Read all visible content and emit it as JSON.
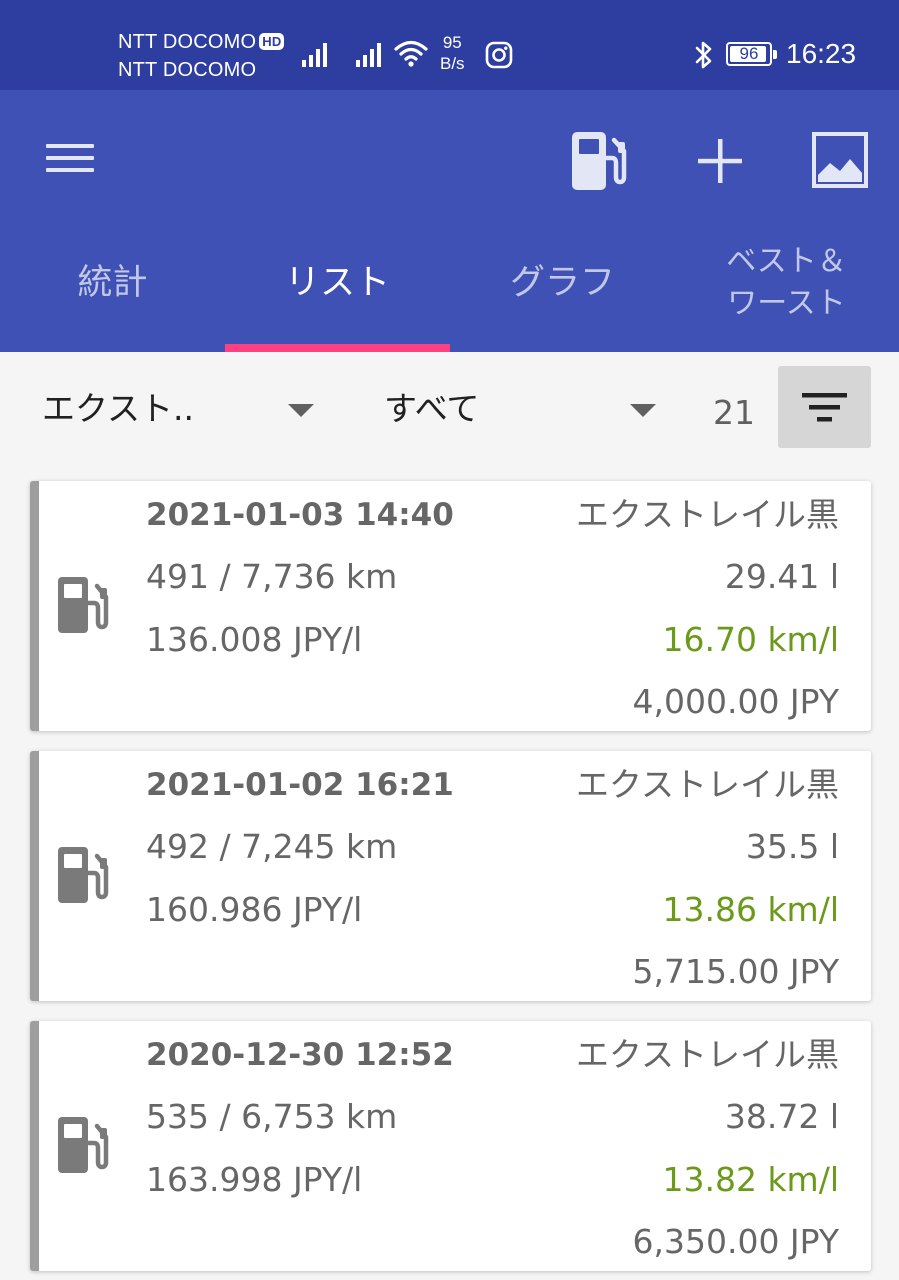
{
  "status_bar": {
    "carrier_1": "NTT DOCOMO",
    "hd_badge": "HD",
    "carrier_2": "NTT DOCOMO",
    "net_speed_value": "95",
    "net_speed_unit": "B/s",
    "battery_percent": "96",
    "battery_level": 0.96,
    "time": "16:23"
  },
  "app_bar": {
    "menu_icon": "hamburger-menu-icon",
    "actions": [
      "fuel-pump-icon",
      "add-icon",
      "image-icon"
    ],
    "background_color": "#3f51b5",
    "status_bar_color": "#2e3ea0"
  },
  "tabs": [
    {
      "label": "統計",
      "active": false
    },
    {
      "label": "リスト",
      "active": true
    },
    {
      "label": "グラフ",
      "active": false
    },
    {
      "label": "ベスト＆ワースト",
      "active": false
    }
  ],
  "tab_indicator_color": "#ff4081",
  "filters": {
    "vehicle_select": "エクスト..",
    "period_select": "すべて",
    "count": "21"
  },
  "entries": [
    {
      "datetime": "2021-01-03 14:40",
      "vehicle": "エクストレイル黒",
      "distance": "491 / 7,736 km",
      "volume": "29.41 l",
      "unit_price": "136.008 JPY/l",
      "efficiency": "16.70 km/l",
      "total": "4,000.00 JPY"
    },
    {
      "datetime": "2021-01-02 16:21",
      "vehicle": "エクストレイル黒",
      "distance": "492 / 7,245 km",
      "volume": "35.5 l",
      "unit_price": "160.986 JPY/l",
      "efficiency": "13.86 km/l",
      "total": "5,715.00 JPY"
    },
    {
      "datetime": "2020-12-30 12:52",
      "vehicle": "エクストレイル黒",
      "distance": "535 / 6,753 km",
      "volume": "38.72 l",
      "unit_price": "163.998 JPY/l",
      "efficiency": "13.82 km/l",
      "total": "6,350.00 JPY"
    }
  ],
  "efficiency_color": "#6b9a1b"
}
